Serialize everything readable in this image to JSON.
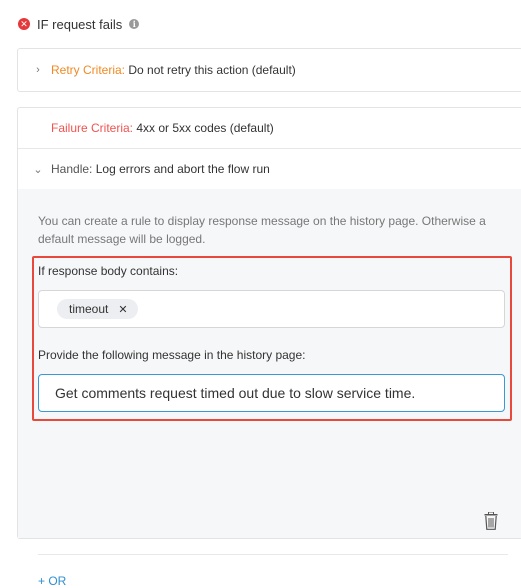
{
  "header": {
    "title": "IF request fails"
  },
  "retry": {
    "label": "Retry Criteria:",
    "value": "Do not retry this action (default)"
  },
  "failure": {
    "label": "Failure Criteria:",
    "value": "4xx or 5xx codes (default)"
  },
  "handle": {
    "label": "Handle:",
    "value": "Log errors and abort the flow run",
    "helper_text": "You can create a rule to display response message on the history page. Otherwise a default message will be logged.",
    "response_body_label": "If response body contains:",
    "tags": [
      "timeout"
    ],
    "message_label": "Provide the following message in the history page:",
    "message_value": "Get comments request timed out due to slow service time.",
    "add_or_label": "+ OR"
  },
  "colors": {
    "retry_label": "#f08a24",
    "failure_label": "#ee5450",
    "highlight": "#e8493c",
    "link": "#2f8fd1",
    "focus_border": "#3a98d6"
  },
  "icons": {
    "header_status": "error-circle-icon",
    "header_info": "info-icon",
    "expand": "chevron-right-icon",
    "collapse": "chevron-down-icon",
    "delete": "trash-icon",
    "chip_remove": "close-icon"
  }
}
